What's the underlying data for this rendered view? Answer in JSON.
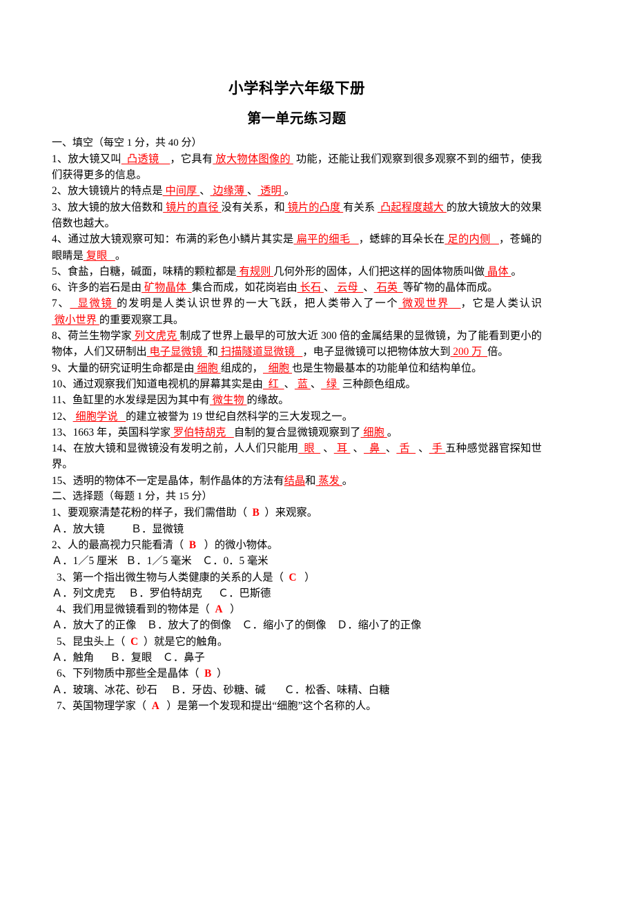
{
  "document": {
    "title": "小学科学六年级下册",
    "subtitle": "第一单元练习题"
  },
  "colors": {
    "answer_red": "#ff0000",
    "text_black": "#000000",
    "page_background": "#ffffff"
  },
  "sections": [
    {
      "heading": "一、填空（每空 1 分，共 40 分）",
      "questions": [
        {
          "number": "1、",
          "parts": [
            {
              "t": "text",
              "v": "放大镜又叫"
            },
            {
              "t": "answer",
              "v": "  凸透镜    "
            },
            {
              "t": "text",
              "v": "，它具有"
            },
            {
              "t": "answer",
              "v": " 放大物体图像的 "
            },
            {
              "t": "text",
              "v": " 功能，还能让我们观察到很多观察不到的细节，使我们获得更多的信息。"
            }
          ]
        },
        {
          "number": "2、",
          "parts": [
            {
              "t": "text",
              "v": "放大镜镜片的特点是"
            },
            {
              "t": "answer",
              "v": " 中间厚 "
            },
            {
              "t": "text",
              "v": "、"
            },
            {
              "t": "answer",
              "v": " 边缘薄 "
            },
            {
              "t": "text",
              "v": "、"
            },
            {
              "t": "answer",
              "v": " 透明 "
            },
            {
              "t": "text",
              "v": "。"
            }
          ]
        },
        {
          "number": "3、",
          "parts": [
            {
              "t": "text",
              "v": "放大镜的放大倍数和"
            },
            {
              "t": "answer",
              "v": " 镜片的直径 "
            },
            {
              "t": "text",
              "v": "没有关系，和"
            },
            {
              "t": "answer",
              "v": " 镜片的凸度 "
            },
            {
              "t": "text",
              "v": "有关系 "
            },
            {
              "t": "answer",
              "v": " 凸起程度越大 "
            },
            {
              "t": "text",
              "v": "的放大镜放大的效果倍数也越大。"
            }
          ]
        },
        {
          "number": "4、",
          "parts": [
            {
              "t": "text",
              "v": "通过放大镜观察可知：布满的彩色小鳞片其实是"
            },
            {
              "t": "answer",
              "v": " 扁平的细毛   "
            },
            {
              "t": "text",
              "v": "，蟋蟀的耳朵长在"
            },
            {
              "t": "answer",
              "v": " 足的内侧   "
            },
            {
              "t": "text",
              "v": "，苍蝇的眼睛是"
            },
            {
              "t": "answer",
              "v": " 复眼   "
            },
            {
              "t": "text",
              "v": "。"
            }
          ]
        },
        {
          "number": "5、",
          "parts": [
            {
              "t": "text",
              "v": "食盐，白糖，碱面，味精的颗粒都是"
            },
            {
              "t": "answer",
              "v": " 有规则 "
            },
            {
              "t": "text",
              "v": "几何外形的固体，人们把这样的固体物质叫做"
            },
            {
              "t": "answer",
              "v": " 晶体 "
            },
            {
              "t": "text",
              "v": "。"
            }
          ]
        },
        {
          "number": "6、",
          "parts": [
            {
              "t": "text",
              "v": "许多的岩石是由"
            },
            {
              "t": "answer",
              "v": " 矿物晶体  "
            },
            {
              "t": "text",
              "v": "集合而成，如花岗岩由"
            },
            {
              "t": "answer",
              "v": " 长石 "
            },
            {
              "t": "text",
              "v": "、"
            },
            {
              "t": "answer",
              "v": " 云母  "
            },
            {
              "t": "text",
              "v": "、"
            },
            {
              "t": "answer",
              "v": " 石英  "
            },
            {
              "t": "text",
              "v": "等矿物的晶体而成。"
            }
          ]
        },
        {
          "number": "7、",
          "parts": [
            {
              "t": "answer",
              "v": "  显微镜 "
            },
            {
              "t": "text",
              "v": "的发明是人类认识世界的一大飞跃，把人类带入了一个"
            },
            {
              "t": "answer",
              "v": " 微观世界   "
            },
            {
              "t": "text",
              "v": "，它是人类认识"
            },
            {
              "t": "answer",
              "v": " 微小世界 "
            },
            {
              "t": "text",
              "v": "的重要观察工具。"
            }
          ]
        },
        {
          "number": "8、",
          "parts": [
            {
              "t": "text",
              "v": "荷兰生物学家"
            },
            {
              "t": "answer",
              "v": " 列文虎克 "
            },
            {
              "t": "text",
              "v": "制成了世界上最早的可放大近 300 倍的金属结果的显微镜，为了能看到更小的物体，人们又研制出"
            },
            {
              "t": "answer",
              "v": " 电子显微镜  "
            },
            {
              "t": "text",
              "v": "和"
            },
            {
              "t": "answer",
              "v": " 扫描隧道显微镜   "
            },
            {
              "t": "text",
              "v": "，电子显微镜可以把物体放大到"
            },
            {
              "t": "answer",
              "v": " 200 万  "
            },
            {
              "t": "text",
              "v": "倍。"
            }
          ]
        },
        {
          "number": "9、",
          "parts": [
            {
              "t": "text",
              "v": "大量的研究证明生命都是由"
            },
            {
              "t": "answer",
              "v": " 细胞 "
            },
            {
              "t": "text",
              "v": "组成的，"
            },
            {
              "t": "answer",
              "v": "  细胞 "
            },
            {
              "t": "text",
              "v": "也是生物最基本的功能单位和结构单位。"
            }
          ]
        },
        {
          "number": "10、",
          "parts": [
            {
              "t": "text",
              "v": "通过观察我们知道电视机的屏幕其实是由"
            },
            {
              "t": "answer",
              "v": "  红  "
            },
            {
              "t": "text",
              "v": "、"
            },
            {
              "t": "answer",
              "v": " 蓝 "
            },
            {
              "t": "text",
              "v": "、"
            },
            {
              "t": "answer",
              "v": "  绿 "
            },
            {
              "t": "text",
              "v": " 三种颜色组成。"
            }
          ]
        },
        {
          "number": "11、",
          "parts": [
            {
              "t": "text",
              "v": "鱼缸里的水发绿是因为其中有"
            },
            {
              "t": "answer",
              "v": " 微生物 "
            },
            {
              "t": "text",
              "v": "的缘故。"
            }
          ]
        },
        {
          "number": "12、",
          "parts": [
            {
              "t": "answer",
              "v": " 细胞学说   "
            },
            {
              "t": "text",
              "v": "的建立被誉为 19 世纪自然科学的三大发现之一。"
            }
          ]
        },
        {
          "number": "13、",
          "parts": [
            {
              "t": "text",
              "v": "1663 年，英国科学家"
            },
            {
              "t": "answer",
              "v": " 罗伯特胡克   "
            },
            {
              "t": "text",
              "v": "自制的复合显微镜观察到了"
            },
            {
              "t": "answer",
              "v": " 细胞 "
            },
            {
              "t": "text",
              "v": "。"
            }
          ]
        },
        {
          "number": "14、",
          "parts": [
            {
              "t": "text",
              "v": "在放大镜和显微镜没有发明之前，人人们只能用"
            },
            {
              "t": "answer",
              "v": "  眼  "
            },
            {
              "t": "text",
              "v": " 、"
            },
            {
              "t": "answer",
              "v": " 耳 "
            },
            {
              "t": "text",
              "v": " 、"
            },
            {
              "t": "answer",
              "v": "  鼻  "
            },
            {
              "t": "text",
              "v": "、"
            },
            {
              "t": "answer",
              "v": " 舌  "
            },
            {
              "t": "text",
              "v": " 、"
            },
            {
              "t": "answer",
              "v": " 手 "
            },
            {
              "t": "text",
              "v": "五种感觉器官探知世界。"
            }
          ]
        },
        {
          "number": "15、",
          "parts": [
            {
              "t": "text",
              "v": "透明的物体不一定是晶体，制作晶体的方法有"
            },
            {
              "t": "answer",
              "v": "结晶"
            },
            {
              "t": "text",
              "v": "和"
            },
            {
              "t": "answer",
              "v": " 蒸发 "
            },
            {
              "t": "text",
              "v": "。"
            }
          ]
        }
      ]
    },
    {
      "heading": "二、选择题（每题 1 分，共 15 分）",
      "questions": [
        {
          "number": "1、",
          "indent": false,
          "stem_before": "要观察清楚花粉的样子，我们需借助（",
          "choice": "  B  ",
          "stem_after": "）来观察。",
          "options": "Ａ．放大镜          Ｂ．显微镜"
        },
        {
          "number": "2、",
          "indent": false,
          "stem_before": "人的最高视力只能看清（",
          "choice": "  B   ",
          "stem_after": "）的微小物体。",
          "options": "Ａ．1／5 厘米   Ｂ．1／5 毫米    Ｃ．0．5 毫米"
        },
        {
          "number": "3、",
          "indent": true,
          "stem_before": "第一个指出微生物与人类健康的关系的人是（",
          "choice": "  C   ",
          "stem_after": "）",
          "options": "Ａ．列文虎克     Ｂ．罗伯特胡克      Ｃ．巴斯德"
        },
        {
          "number": "4、",
          "indent": true,
          "stem_before": "我们用显微镜看到的物体是（",
          "choice": "  A   ",
          "stem_after": "）",
          "options": "Ａ．放大了的正像    Ｂ．放大了的倒像    Ｃ．缩小了的倒像    Ｄ．缩小了的正像"
        },
        {
          "number": "5、",
          "indent": true,
          "stem_before": "昆虫头上（",
          "choice": "  C  ",
          "stem_after": "）就是它的触角。",
          "options": "Ａ．触角      Ｂ．复眼    Ｃ．鼻子"
        },
        {
          "number": "6、",
          "indent": true,
          "stem_before": "下列物质中那些全是晶体（",
          "choice": "  B  ",
          "stem_after": "）",
          "options": "Ａ．玻璃、冰花、砂石     Ｂ．牙齿、砂糖、碱       Ｃ．松香、味精、白糖"
        },
        {
          "number": "7、",
          "indent": true,
          "stem_before": "英国物理学家（",
          "choice": "  A   ",
          "stem_after": "）是第一个发现和提出“细胞”这个名称的人。",
          "options": ""
        }
      ]
    }
  ]
}
